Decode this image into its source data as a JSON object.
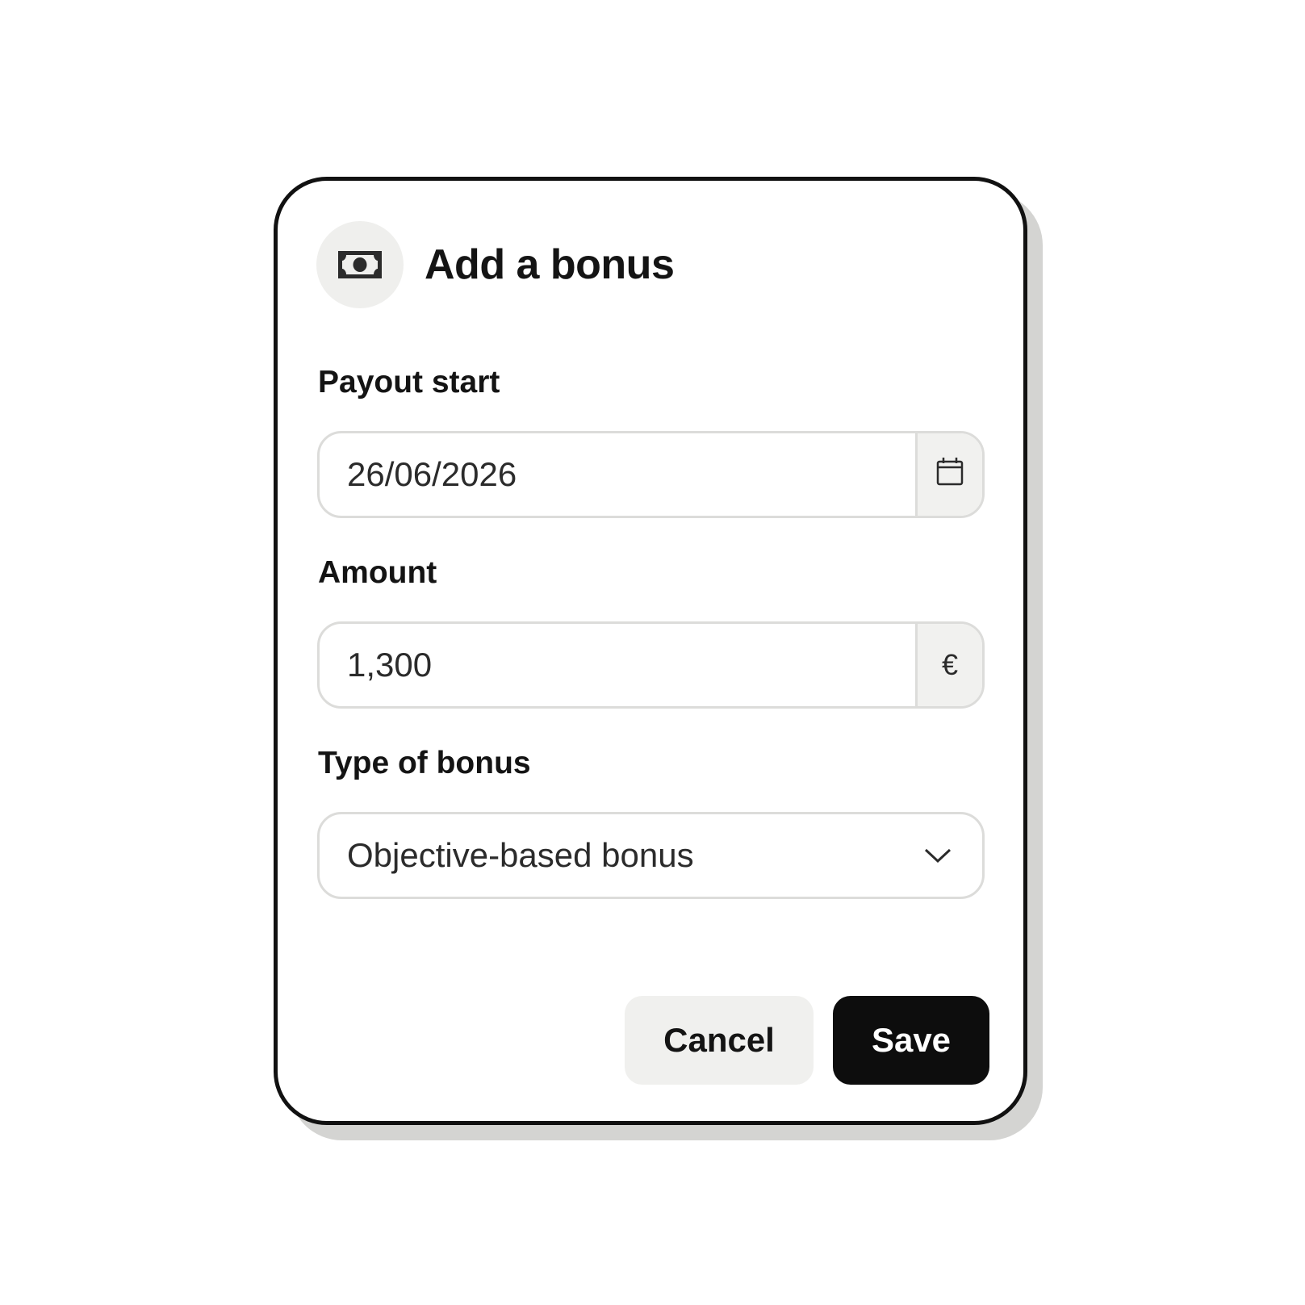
{
  "dialog": {
    "title": "Add a bonus",
    "header_icon": "banknote-icon"
  },
  "fields": {
    "payout_start": {
      "label": "Payout start",
      "value": "26/06/2026",
      "addon_icon": "calendar-icon"
    },
    "amount": {
      "label": "Amount",
      "value": "1,300",
      "currency": "€"
    },
    "bonus_type": {
      "label": "Type of bonus",
      "selected": "Objective-based bonus",
      "caret_icon": "chevron-down-icon"
    }
  },
  "actions": {
    "cancel_label": "Cancel",
    "save_label": "Save"
  },
  "colors": {
    "primary": "#0d0d0d",
    "secondary_bg": "#f0f0ee",
    "border": "#dcdcda"
  }
}
